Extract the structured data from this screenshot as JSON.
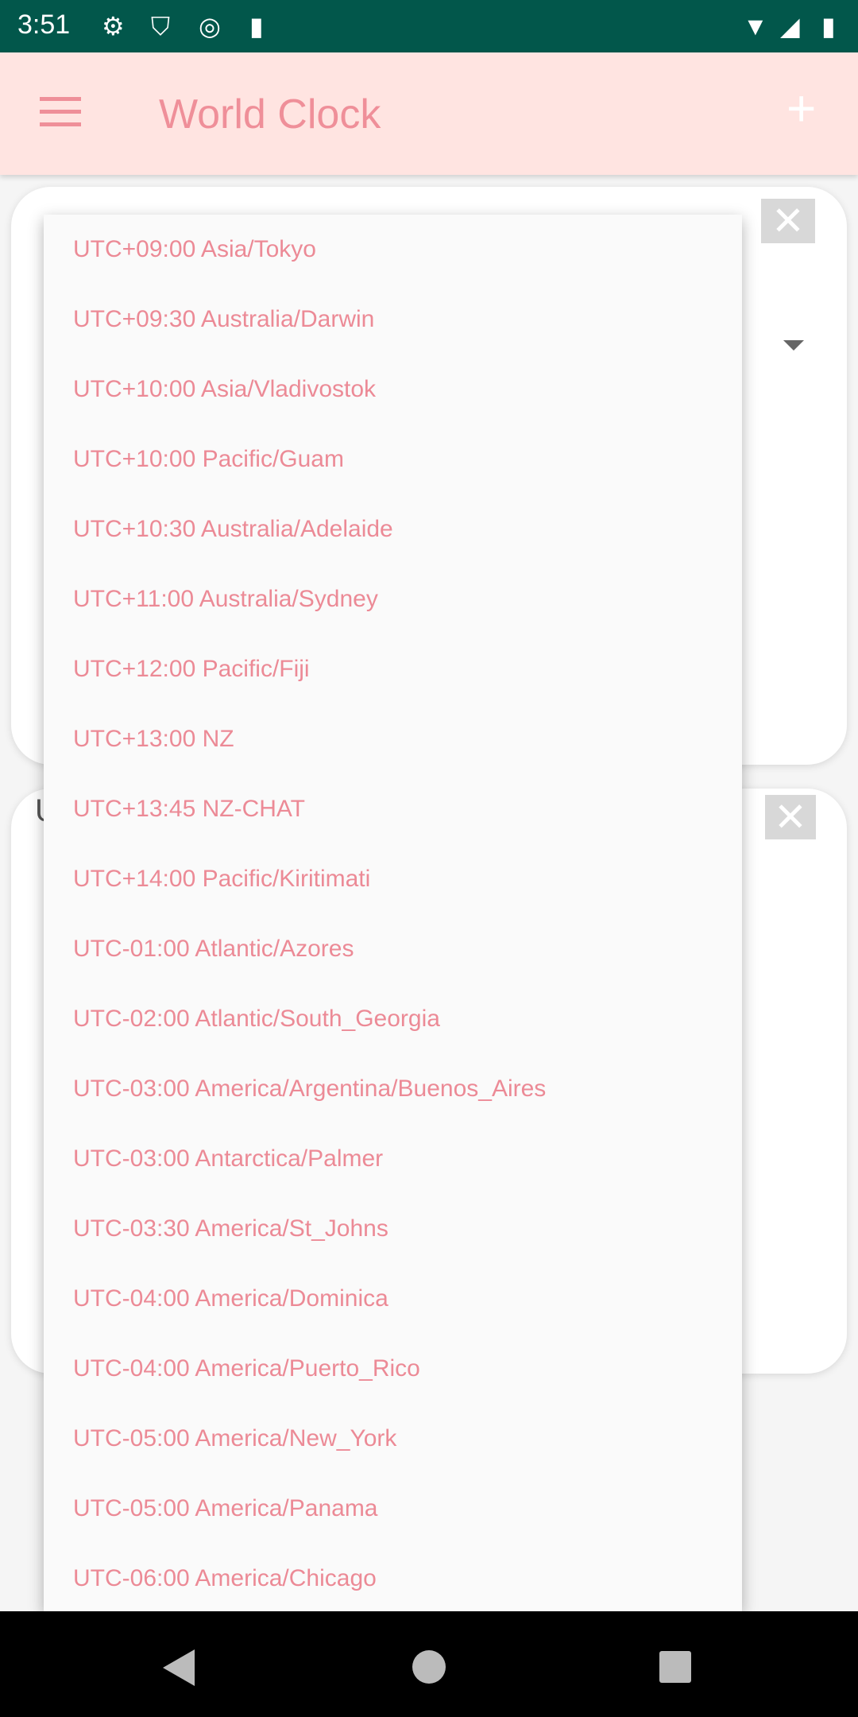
{
  "status_bar": {
    "time": "3:51",
    "icons": [
      "gear-icon",
      "shield-play-icon",
      "q-icon",
      "sd-card-icon",
      "wifi-icon",
      "signal-icon",
      "battery-icon"
    ]
  },
  "app_bar": {
    "title": "World Clock",
    "menu_icon": "hamburger-icon",
    "add_icon": "plus-icon"
  },
  "cards": [
    {
      "close_label": "✕"
    },
    {
      "close_label": "✕",
      "partial_text": "U"
    }
  ],
  "dropdown": {
    "items": [
      "UTC+09:00 Asia/Tokyo",
      "UTC+09:30 Australia/Darwin",
      "UTC+10:00 Asia/Vladivostok",
      "UTC+10:00 Pacific/Guam",
      "UTC+10:30 Australia/Adelaide",
      "UTC+11:00 Australia/Sydney",
      "UTC+12:00 Pacific/Fiji",
      "UTC+13:00 NZ",
      "UTC+13:45 NZ-CHAT",
      "UTC+14:00 Pacific/Kiritimati",
      "UTC-01:00 Atlantic/Azores",
      "UTC-02:00 Atlantic/South_Georgia",
      "UTC-03:00 America/Argentina/Buenos_Aires",
      "UTC-03:00 Antarctica/Palmer",
      "UTC-03:30 America/St_Johns",
      "UTC-04:00 America/Dominica",
      "UTC-04:00 America/Puerto_Rico",
      "UTC-05:00 America/New_York",
      "UTC-05:00 America/Panama",
      "UTC-06:00 America/Chicago"
    ]
  },
  "colors": {
    "status_bar": "#02574b",
    "app_bar": "#ffe4e1",
    "accent": "#ef8f99"
  }
}
